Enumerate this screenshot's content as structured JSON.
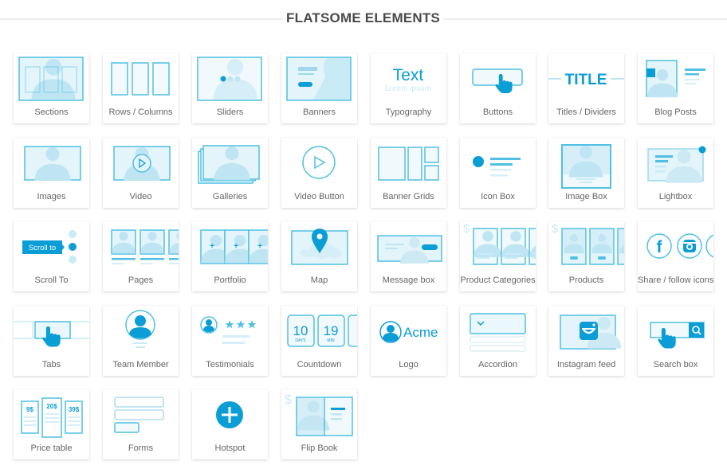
{
  "header": {
    "title": "FLATSOME ELEMENTS"
  },
  "colors": {
    "accent": "#0a9dd6",
    "stroke": "#4fc0e4",
    "fill": "#e3f4fb",
    "silhouette": "#bfe5f3",
    "label": "#666666",
    "title": "#4a4a4a"
  },
  "elements": [
    {
      "label": "Sections",
      "icon": "sections-icon"
    },
    {
      "label": "Rows / Columns",
      "icon": "rows-columns-icon"
    },
    {
      "label": "Sliders",
      "icon": "sliders-icon"
    },
    {
      "label": "Banners",
      "icon": "banners-icon"
    },
    {
      "label": "Typography",
      "icon": "typography-icon",
      "icon_text": "Text",
      "icon_subtext": "Lorem ipsum"
    },
    {
      "label": "Buttons",
      "icon": "buttons-icon"
    },
    {
      "label": "Titles / Dividers",
      "icon": "titles-dividers-icon",
      "icon_text": "TITLE"
    },
    {
      "label": "Blog Posts",
      "icon": "blog-posts-icon"
    },
    {
      "label": "Images",
      "icon": "images-icon"
    },
    {
      "label": "Video",
      "icon": "video-icon"
    },
    {
      "label": "Galleries",
      "icon": "galleries-icon"
    },
    {
      "label": "Video Button",
      "icon": "video-button-icon"
    },
    {
      "label": "Banner Grids",
      "icon": "banner-grids-icon"
    },
    {
      "label": "Icon Box",
      "icon": "icon-box-icon"
    },
    {
      "label": "Image Box",
      "icon": "image-box-icon"
    },
    {
      "label": "Lightbox",
      "icon": "lightbox-icon"
    },
    {
      "label": "Scroll To",
      "icon": "scroll-to-icon",
      "icon_text": "Scroll to"
    },
    {
      "label": "Pages",
      "icon": "pages-icon"
    },
    {
      "label": "Portfolio",
      "icon": "portfolio-icon"
    },
    {
      "label": "Map",
      "icon": "map-icon"
    },
    {
      "label": "Message box",
      "icon": "message-box-icon"
    },
    {
      "label": "Product Categories",
      "icon": "product-categories-icon",
      "icon_text": "$"
    },
    {
      "label": "Products",
      "icon": "products-icon",
      "icon_text": "$"
    },
    {
      "label": "Share / follow icons",
      "icon": "share-follow-icon",
      "icon_text": "f"
    },
    {
      "label": "Tabs",
      "icon": "tabs-icon"
    },
    {
      "label": "Team Member",
      "icon": "team-member-icon"
    },
    {
      "label": "Testimonials",
      "icon": "testimonials-icon"
    },
    {
      "label": "Countdown",
      "icon": "countdown-icon",
      "icon_values": [
        "10",
        "19"
      ],
      "icon_units": [
        "DAYS",
        "MIN"
      ]
    },
    {
      "label": "Logo",
      "icon": "logo-icon",
      "icon_text": "Acme"
    },
    {
      "label": "Accordion",
      "icon": "accordion-icon"
    },
    {
      "label": "Instagram feed",
      "icon": "instagram-feed-icon"
    },
    {
      "label": "Search box",
      "icon": "search-box-icon"
    },
    {
      "label": "Price table",
      "icon": "price-table-icon",
      "icon_values": [
        "9$",
        "20$",
        "39$"
      ]
    },
    {
      "label": "Forms",
      "icon": "forms-icon"
    },
    {
      "label": "Hotspot",
      "icon": "hotspot-icon"
    },
    {
      "label": "Flip Book",
      "icon": "flip-book-icon",
      "icon_text": "$"
    }
  ]
}
